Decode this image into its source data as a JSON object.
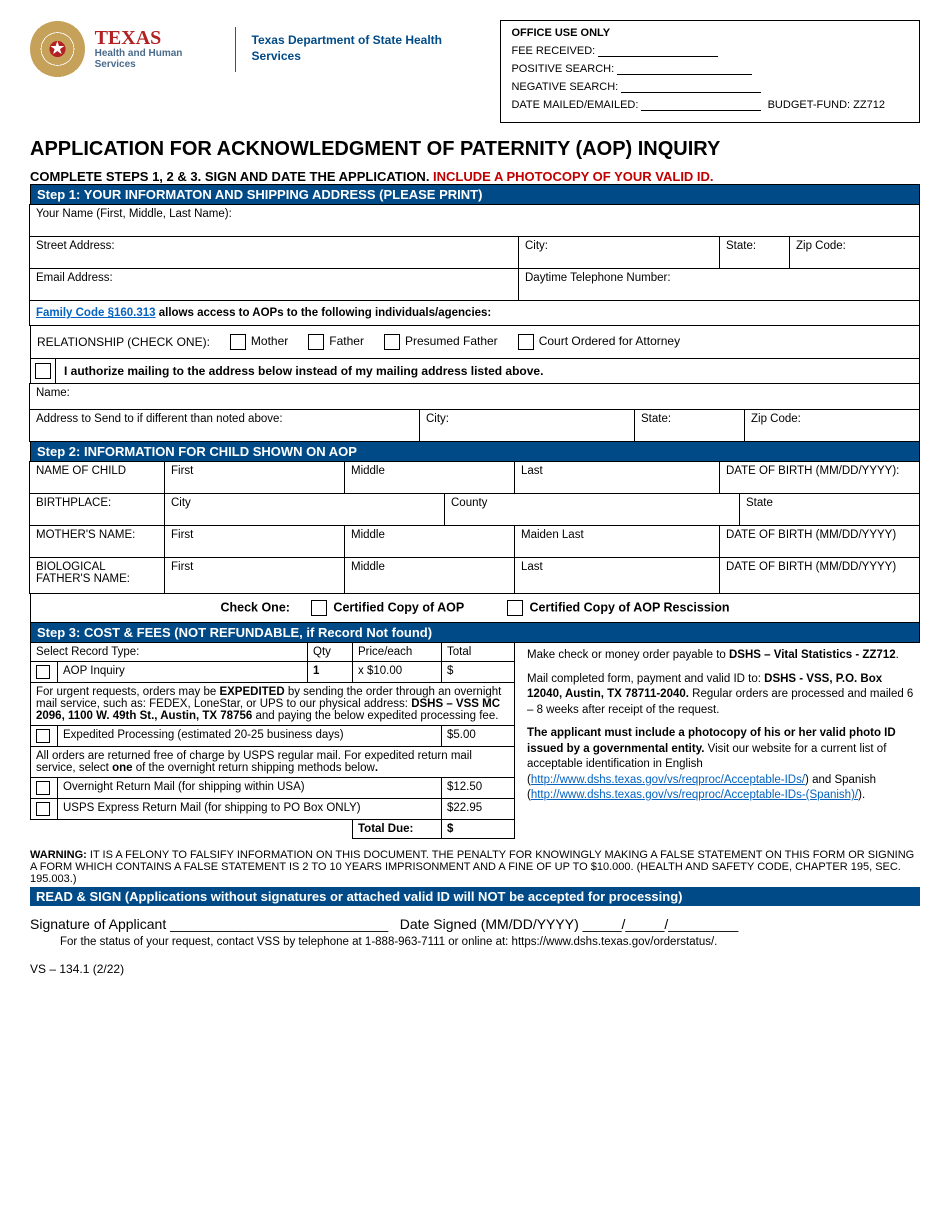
{
  "logo": {
    "state": "TEXAS",
    "hhs": "Health and Human Services",
    "dept": "Texas Department of State Health Services"
  },
  "office": {
    "hdr": "OFFICE USE ONLY",
    "fee": "FEE RECEIVED:",
    "pos": "POSITIVE SEARCH:",
    "neg": "NEGATIVE SEARCH:",
    "mailed": "DATE MAILED/EMAILED:",
    "budget": "BUDGET-FUND: ZZ712"
  },
  "title": "APPLICATION FOR ACKNOWLEDGMENT OF PATERNITY (AOP) INQUIRY",
  "instr1": "COMPLETE STEPS 1, 2 & 3. SIGN AND DATE THE APPLICATION. ",
  "instr2": "INCLUDE A PHOTOCOPY OF YOUR VALID ID.",
  "step1": {
    "hdr": "Step 1: YOUR INFORMATON AND SHIPPING ADDRESS (PLEASE PRINT)",
    "name": "Your Name (First, Middle, Last Name):",
    "street": "Street Address:",
    "city": "City:",
    "state": "State:",
    "zip": "Zip Code:",
    "email": "Email Address:",
    "phone": "Daytime Telephone Number:",
    "fc_link": "Family Code §160.313",
    "fc_rest": " allows access to AOPs to the following individuals/agencies:",
    "rel_lbl": "RELATIONSHIP (CHECK ONE):",
    "rel_mother": "Mother",
    "rel_father": "Father",
    "rel_presumed": "Presumed Father",
    "rel_court": "Court Ordered for Attorney",
    "auth": "I authorize mailing to the address below instead of my mailing address listed above.",
    "altname": "Name:",
    "altaddr": "Address to Send to if different than noted above:",
    "altcity": "City:",
    "altstate": "State:",
    "altzip": "Zip Code:"
  },
  "step2": {
    "hdr": "Step 2: INFORMATION FOR CHILD SHOWN ON AOP",
    "childname": "NAME OF CHILD",
    "first": "First",
    "middle": "Middle",
    "last": "Last",
    "dob": "DATE OF BIRTH (MM/DD/YYYY):",
    "dob2": "DATE OF BIRTH (MM/DD/YYYY)",
    "bp": "BIRTHPLACE:",
    "city": "City",
    "county": "County",
    "state": "State",
    "mother": "MOTHER'S NAME:",
    "maiden": "Maiden Last",
    "father": "BIOLOGICAL FATHER'S NAME:",
    "chk": "Check One:",
    "cert1": "Certified Copy of AOP",
    "cert2": "Certified Copy of AOP Rescission"
  },
  "step3": {
    "hdr": "Step 3: COST & FEES (NOT REFUNDABLE, if Record Not found)",
    "selrec": "Select Record Type:",
    "qty": "Qty",
    "priceeach": "Price/each",
    "total": "Total",
    "aop": "AOP Inquiry",
    "one": "1",
    "price": "x $10.00",
    "dollar": "$",
    "urgent1": "For urgent requests, orders may be ",
    "urgent_b": "EXPEDITED",
    "urgent2": " by sending the order through an overnight mail service, such as: FEDEX, LoneStar, or UPS to our physical address: ",
    "urgent_addr": "DSHS – VSS MC 2096, 1100 W. 49th St., Austin, TX 78756",
    "urgent3": " and paying the below expedited processing fee.",
    "exp": "Expedited Processing (estimated 20-25 business days)",
    "expfee": "$5.00",
    "ret1": "All orders are returned free of charge by USPS regular mail.  For expedited return mail service, select ",
    "ret_b": "one",
    "ret2": " of the overnight return shipping methods below",
    "ov1": "Overnight Return Mail (for shipping within USA)",
    "ov1fee": "$12.50",
    "ov2": "USPS Express Return Mail (for shipping to PO Box ONLY)",
    "ov2fee": "$22.95",
    "tdue": "Total Due:",
    "payable1": "Make check or money order payable to ",
    "payable_b": "DSHS – Vital Statistics - ZZ712",
    "mail1": "Mail completed form, payment and valid ID to: ",
    "mail_b": "DSHS - VSS, P.O. Box 12040, Austin, TX 78711-2040.",
    "mail2": " Regular orders are processed and mailed 6 – 8 weeks after receipt of the request.",
    "id1": "The applicant must include a photocopy of his or her valid photo ID issued by a governmental entity.",
    "id2": " Visit our website for a current list of acceptable identification in English (",
    "id_link1": "http://www.dshs.texas.gov/vs/reqproc/Acceptable-IDs/",
    "id3": ") and Spanish (",
    "id_link2": "http://www.dshs.texas.gov/vs/reqproc/Acceptable-IDs-(Spanish)/",
    "id4": ")."
  },
  "warn_b": "WARNING:",
  "warn": " IT IS A FELONY TO FALSIFY INFORMATION ON THIS DOCUMENT. THE PENALTY FOR KNOWINGLY MAKING A FALSE STATEMENT ON THIS FORM OR SIGNING A FORM WHICH CONTAINS A FALSE STATEMENT IS 2 TO 10 YEARS IMPRISONMENT AND A FINE OF UP TO $10.000. (HEALTH AND SAFETY CODE, CHAPTER 195, SEC. 195.003.)",
  "sign_hdr": "READ & SIGN (Applications without signatures or attached valid ID will NOT be accepted for processing)",
  "sig": "Signature of Applicant ____________________________",
  "datesig": "Date Signed (MM/DD/YYYY)  _____/_____/_________",
  "status": "For the status of your request, contact VSS by telephone at 1-888-963-7111 or online at: https://www.dshs.texas.gov/orderstatus/.",
  "formno": "VS – 134.1 (2/22)"
}
